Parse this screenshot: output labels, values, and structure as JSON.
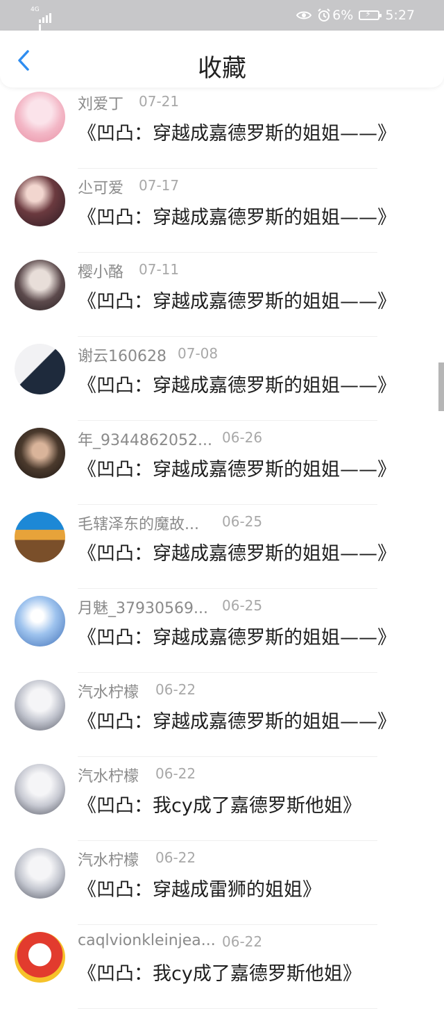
{
  "status_bar": {
    "network": "4G",
    "battery": "6%",
    "time": "5:27"
  },
  "header": {
    "title": "收藏",
    "back_icon": "chevron-left-icon"
  },
  "colors": {
    "accent": "#2f8df0",
    "status_bar_bg": "#c7c7c9",
    "name_text": "#8a8a8a",
    "title_text": "#1e1e1e"
  },
  "favorites": [
    {
      "user": "刘爱丁",
      "date": "07-21",
      "title": "《凹凸：穿越成嘉德罗斯的姐姐——》"
    },
    {
      "user": "尐可爱",
      "date": "07-17",
      "title": "《凹凸：穿越成嘉德罗斯的姐姐——》"
    },
    {
      "user": "樱小酪",
      "date": "07-11",
      "title": "《凹凸：穿越成嘉德罗斯的姐姐——》"
    },
    {
      "user": "谢云160628",
      "date": "07-08",
      "title": "《凹凸：穿越成嘉德罗斯的姐姐——》"
    },
    {
      "user": "年_9344862052...",
      "date": "06-26",
      "title": "《凹凸：穿越成嘉德罗斯的姐姐——》"
    },
    {
      "user": "毛辖泽东的魔故...",
      "date": "06-25",
      "title": "《凹凸：穿越成嘉德罗斯的姐姐——》"
    },
    {
      "user": "月魅_37930569...",
      "date": "06-25",
      "title": "《凹凸：穿越成嘉德罗斯的姐姐——》"
    },
    {
      "user": "汽水柠檬",
      "date": "06-22",
      "title": "《凹凸：穿越成嘉德罗斯的姐姐——》"
    },
    {
      "user": "汽水柠檬",
      "date": "06-22",
      "title": "《凹凸：我cy成了嘉德罗斯他姐》"
    },
    {
      "user": "汽水柠檬",
      "date": "06-22",
      "title": "《凹凸：穿越成雷狮的姐姐》"
    },
    {
      "user": "caqlvionkleinjea...",
      "date": "06-22",
      "title": "《凹凸：我cy成了嘉德罗斯他姐》"
    }
  ]
}
